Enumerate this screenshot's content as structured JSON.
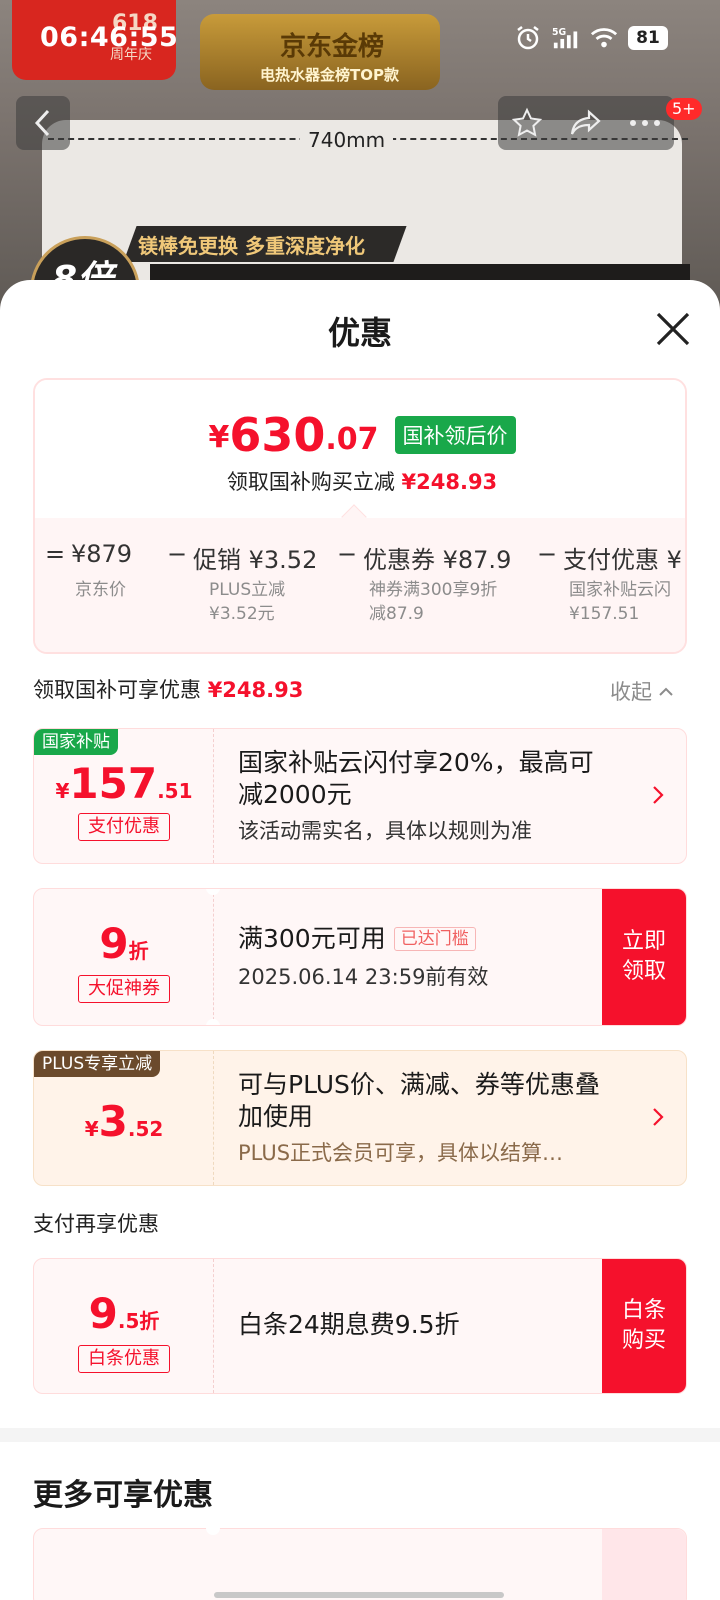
{
  "status_bar": {
    "time": "06:46:55",
    "network": "5G",
    "battery": "81"
  },
  "background": {
    "promo_618": "618",
    "promo_618_sub": "周年庆",
    "gold_title": "京东金榜",
    "gold_sub": "电热水器金榜TOP款",
    "dimension": "740mm",
    "feature_strip": "镁棒免更换 多重深度净化",
    "circle_text": "8倍",
    "nav_badge": "5+"
  },
  "sheet": {
    "title": "优惠",
    "price_card": {
      "yen": "¥",
      "price_int": "630",
      "price_dec": ".07",
      "tag": "国补领后价",
      "sub_prefix": "领取国补购买立减",
      "sub_amount": "¥248.93",
      "breakdown": [
        {
          "op": "=",
          "value": "¥879",
          "label": "京东价"
        },
        {
          "op": "−",
          "value": "促销 ¥3.52",
          "label": "PLUS立减\n¥3.52元"
        },
        {
          "op": "−",
          "value": "优惠券 ¥87.9",
          "label": "神券满300享9折\n减87.9"
        },
        {
          "op": "−",
          "value": "支付优惠 ¥",
          "label": "国家补贴云闪\n¥157.51"
        }
      ]
    },
    "section1": {
      "label": "领取国补可享优惠",
      "amount": "¥248.93",
      "collapse": "收起"
    },
    "coupons": [
      {
        "corner": "国家补贴",
        "amount_prefix": "¥",
        "amount_big": "157",
        "amount_small": ".51",
        "tag": "支付优惠",
        "title": "国家补贴云闪付享20%，最高可减2000元",
        "desc": "该活动需实名，具体以规则为准"
      },
      {
        "amount_big": "9",
        "amount_small": "折",
        "tag": "大促神券",
        "title": "满300元可用",
        "badge": "已达门槛",
        "desc": "2025.06.14 23:59前有效",
        "cta": "立即领取"
      },
      {
        "corner": "PLUS专享立减",
        "amount_prefix": "¥",
        "amount_big": "3",
        "amount_small": ".52",
        "title": "可与PLUS价、满减、券等优惠叠加使用",
        "desc": "PLUS正式会员可享，具体以结算…"
      }
    ],
    "section2": {
      "label": "支付再享优惠"
    },
    "pay_coupon": {
      "amount_big": "9",
      "amount_small": ".5折",
      "tag": "白条优惠",
      "title": "白条24期息费9.5折",
      "cta": "白条购买"
    },
    "more_title": "更多可享优惠"
  },
  "colors": {
    "accent_red": "#f5112c",
    "subsidy_green": "#19a84a",
    "plus_brown": "#6b4a2c"
  }
}
